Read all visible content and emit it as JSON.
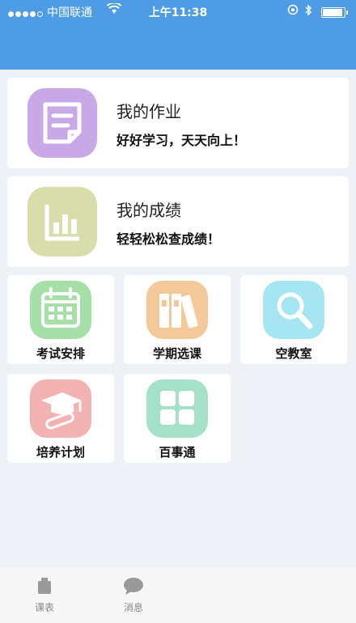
{
  "status": {
    "carrier": "中国联通",
    "time": "上午11:38"
  },
  "cards": [
    {
      "title": "我的作业",
      "subtitle": "好好学习，天天向上！",
      "icon": "homework-note-icon",
      "color": "#c9a8e8"
    },
    {
      "title": "我的成绩",
      "subtitle": "轻轻松松查成绩！",
      "icon": "bar-chart-icon",
      "color": "#d9dcab"
    }
  ],
  "grid": [
    {
      "label": "考试安排",
      "icon": "calendar-icon",
      "color": "#a6e0a8"
    },
    {
      "label": "学期选课",
      "icon": "books-icon",
      "color": "#f3c99a"
    },
    {
      "label": "空教室",
      "icon": "magnifier-icon",
      "color": "#a6e6f2"
    },
    {
      "label": "培养计划",
      "icon": "graduation-cap-icon",
      "color": "#f4b3b3"
    },
    {
      "label": "百事通",
      "icon": "grid-four-icon",
      "color": "#a5e0c8"
    }
  ],
  "tabs": [
    {
      "label": "课表",
      "icon": "timetable-icon"
    },
    {
      "label": "消息",
      "icon": "chat-bubble-icon"
    }
  ]
}
